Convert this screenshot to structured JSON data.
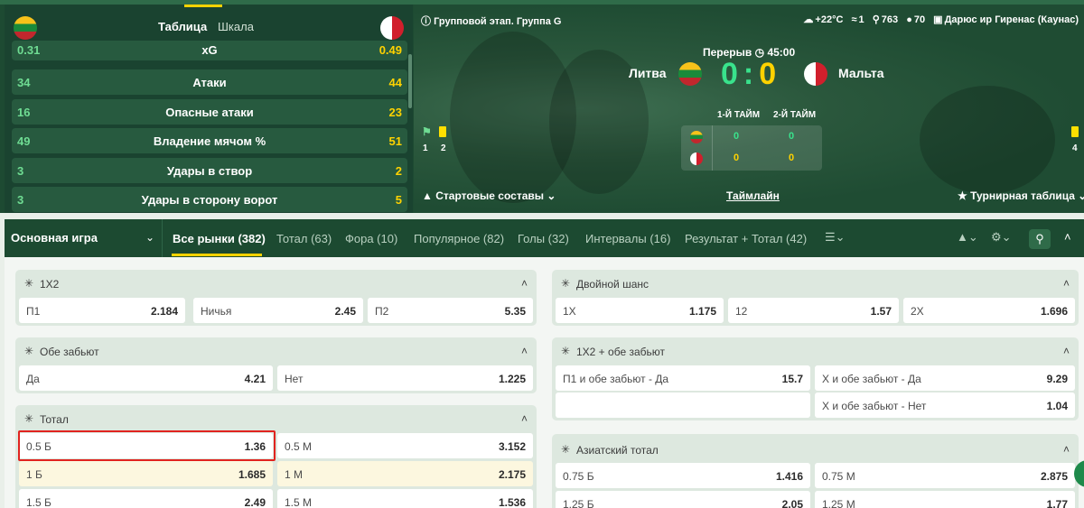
{
  "stats": {
    "tabs": [
      "Таблица",
      "Шкала"
    ],
    "rows": [
      {
        "left": "0.31",
        "label": "xG",
        "right": "0.49"
      },
      {
        "left": "34",
        "label": "Атаки",
        "right": "44"
      },
      {
        "left": "16",
        "label": "Опасные атаки",
        "right": "23"
      },
      {
        "left": "49",
        "label": "Владение мячом %",
        "right": "51"
      },
      {
        "left": "3",
        "label": "Удары в створ",
        "right": "2"
      },
      {
        "left": "3",
        "label": "Удары в сторону ворот",
        "right": "5"
      }
    ]
  },
  "match": {
    "title": "Групповой этап. Группа G",
    "weather": {
      "temp": "+22°C",
      "wind": "1",
      "pressure": "763",
      "humidity": "70",
      "stadium": "Дарюс ир Гиренас (Каунас)"
    },
    "period": "Перерыв",
    "time": "45:00",
    "home": "Литва",
    "away": "Мальта",
    "home_score": "0",
    "separator": ":",
    "away_score": "0",
    "half_labels": [
      "1-Й ТАЙМ",
      "2-Й ТАЙМ"
    ],
    "home_halves": [
      "0",
      "0"
    ],
    "away_halves": [
      "0",
      "0"
    ],
    "home_corners": "1",
    "home_yellow": "2",
    "away_yellow": "4",
    "footer": {
      "lineups": "Стартовые составы",
      "timeline": "Таймлайн",
      "table": "Турнирная таблица"
    }
  },
  "tabbar": {
    "main": "Основная игра",
    "tabs": [
      "Все рынки (382)",
      "Тотал (63)",
      "Фора (10)",
      "Популярное (82)",
      "Голы (32)",
      "Интервалы (16)",
      "Результат + Тотал (42)"
    ]
  },
  "markets": {
    "m1x2": {
      "title": "1X2",
      "odds": [
        {
          "n": "П1",
          "v": "2.184"
        },
        {
          "n": "Ничья",
          "v": "2.45"
        },
        {
          "n": "П2",
          "v": "5.35"
        }
      ]
    },
    "double": {
      "title": "Двойной шанс",
      "odds": [
        {
          "n": "1X",
          "v": "1.175"
        },
        {
          "n": "12",
          "v": "1.57"
        },
        {
          "n": "2X",
          "v": "1.696"
        }
      ]
    },
    "btts": {
      "title": "Обе забьют",
      "odds": [
        {
          "n": "Да",
          "v": "4.21"
        },
        {
          "n": "Нет",
          "v": "1.225"
        }
      ]
    },
    "x2btts": {
      "title": "1X2 + обе забьют",
      "odds": [
        {
          "n": "П1 и обе забьют - Да",
          "v": "15.7"
        },
        {
          "n": "Х и обе забьют - Да",
          "v": "9.29"
        },
        {
          "n": "Х и обе забьют - Нет",
          "v": "1.04"
        }
      ]
    },
    "total": {
      "title": "Тотал",
      "odds": [
        {
          "n": "0.5 Б",
          "v": "1.36"
        },
        {
          "n": "0.5 М",
          "v": "3.152"
        },
        {
          "n": "1 Б",
          "v": "1.685"
        },
        {
          "n": "1 М",
          "v": "2.175"
        },
        {
          "n": "1.5 Б",
          "v": "2.49"
        },
        {
          "n": "1.5 М",
          "v": "1.536"
        }
      ]
    },
    "asian": {
      "title": "Азиатский тотал",
      "odds": [
        {
          "n": "0.75 Б",
          "v": "1.416"
        },
        {
          "n": "0.75 М",
          "v": "2.875"
        },
        {
          "n": "1.25 Б",
          "v": "2.05"
        },
        {
          "n": "1.25 М",
          "v": "1.77"
        }
      ]
    }
  }
}
